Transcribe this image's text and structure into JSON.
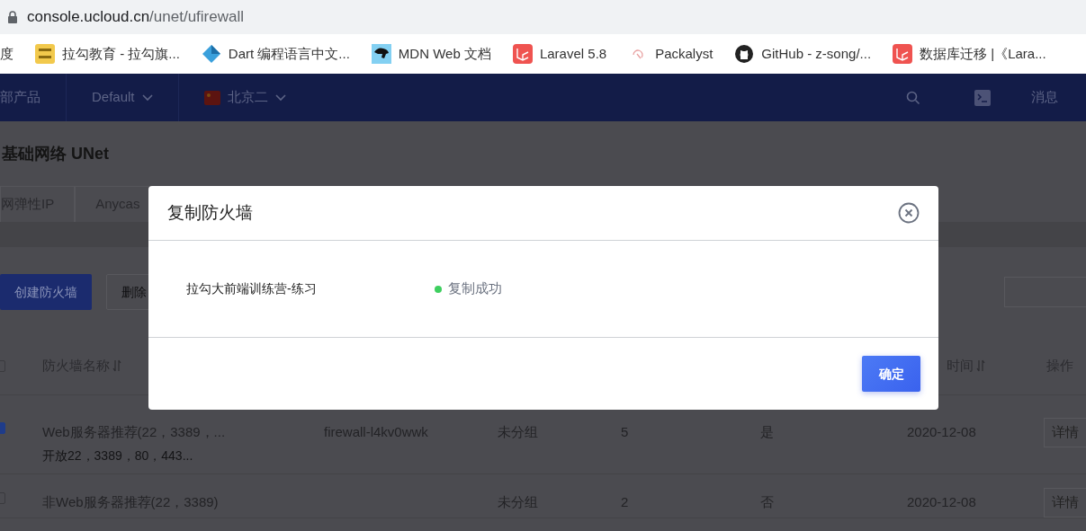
{
  "browser": {
    "url_host": "console.ucloud.cn",
    "url_path": "/unet/ufirewall",
    "bookmarks": [
      {
        "kind": "plain",
        "label": "度"
      },
      {
        "kind": "badge",
        "label": "拉勾教育 - 拉勾旗..."
      },
      {
        "kind": "dart",
        "label": "Dart 编程语言中文..."
      },
      {
        "kind": "mdn",
        "label": "MDN Web 文档"
      },
      {
        "kind": "laravel",
        "label": "Laravel 5.8"
      },
      {
        "kind": "pkg",
        "label": "Packalyst"
      },
      {
        "kind": "github",
        "label": "GitHub - z-song/..."
      },
      {
        "kind": "laravel",
        "label": "数据库迁移 |《Lara..."
      }
    ]
  },
  "header": {
    "products": "部产品",
    "project": "Default",
    "region": "北京二",
    "messages": "消息"
  },
  "page_title": "基础网络 UNet",
  "tabs": [
    {
      "label": "网弹性IP",
      "selected": false
    },
    {
      "label": "Anycas",
      "selected": false
    }
  ],
  "toolbar": {
    "buttons": [
      {
        "kind": "primary",
        "label": "创建防火墙"
      },
      {
        "kind": "plain",
        "label": "删除"
      }
    ]
  },
  "table": {
    "header_checked": false,
    "columns": [
      {
        "label": "防火墙名称",
        "sortable": true
      },
      {
        "label": "时间",
        "sortable": true
      },
      {
        "label": "操作",
        "sortable": false
      }
    ],
    "rows": [
      {
        "checked": true,
        "name": "Web服务器推荐(22，3389，...",
        "remark": "开放22，3389，80，443...",
        "id": "firewall-l4kv0wwk",
        "group": "未分组",
        "count": "5",
        "default": "是",
        "created": "2020-12-08",
        "action": "详情"
      },
      {
        "checked": false,
        "name": "非Web服务器推荐(22，3389)",
        "group": "未分组",
        "count": "2",
        "default": "否",
        "created": "2020-12-08",
        "action": "详情"
      }
    ]
  },
  "modal": {
    "title": "复制防火墙",
    "items": [
      {
        "name": "拉勾大前端训练营-练习",
        "status": "复制成功",
        "color": "#3ecf5f"
      }
    ],
    "confirm": "确定"
  }
}
